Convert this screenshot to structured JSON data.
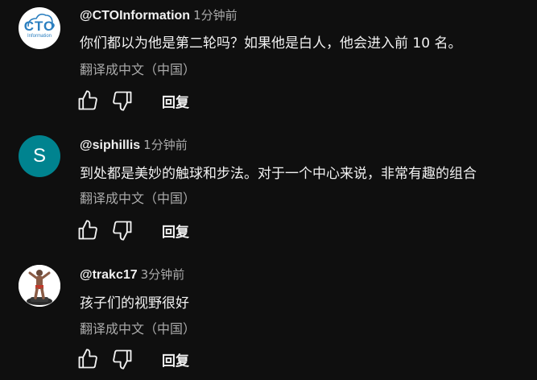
{
  "comments": [
    {
      "author": "@CTOInformation",
      "time": "1分钟前",
      "text": "你们都以为他是第二轮吗？如果他是白人，他会进入前 10 名。",
      "translate": "翻译成中文（中国）",
      "reply": "回复",
      "avatar": {
        "type": "logo",
        "logo_text": "CTO",
        "logo_sub": "Information",
        "color": "#2b7fc0"
      }
    },
    {
      "author": "@siphillis",
      "time": "1分钟前",
      "text": "到处都是美妙的触球和步法。对于一个中心来说，非常有趣的组合",
      "translate": "翻译成中文（中国）",
      "reply": "回复",
      "avatar": {
        "type": "letter",
        "initial": "S",
        "color": "#00838f"
      }
    },
    {
      "author": "@trakc17",
      "time": "3分钟前",
      "text": "孩子们的视野很好",
      "translate": "翻译成中文（中国）",
      "reply": "回复",
      "avatar": {
        "type": "photo"
      }
    }
  ],
  "icons": {
    "like": "thumbs-up-icon",
    "dislike": "thumbs-down-icon"
  }
}
